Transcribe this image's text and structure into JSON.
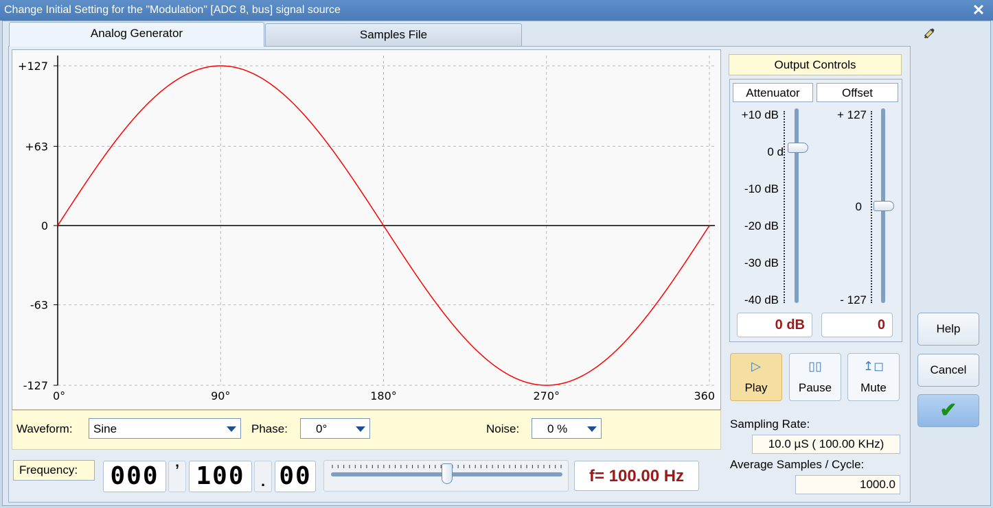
{
  "window": {
    "title": "Change Initial Setting for the \"Modulation\" [ADC 8, bus] signal source",
    "close_glyph": "✕"
  },
  "tabs": [
    {
      "label": "Analog Generator",
      "active": true
    },
    {
      "label": "Samples File",
      "active": false
    }
  ],
  "colors": {
    "accent": "#4a7cb8",
    "signal": "#ff0000",
    "highlight": "#fffbd6",
    "value_text": "#9a1a1a",
    "ok_check": "#1a8f1a"
  },
  "chart_data": {
    "type": "line",
    "series": [
      {
        "name": "",
        "function": "sine",
        "amplitude": 127,
        "x_range": [
          0,
          360
        ]
      }
    ],
    "x_tick_labels": [
      "0°",
      "90°",
      "180°",
      "270°",
      "360"
    ],
    "x_ticks": [
      0,
      90,
      180,
      270,
      360
    ],
    "y_tick_labels": [
      "+127",
      "+63",
      "0",
      "-63",
      "-127"
    ],
    "y_ticks": [
      127,
      63,
      0,
      -63,
      -127
    ],
    "xlim": [
      0,
      360
    ],
    "ylim": [
      -127,
      127
    ],
    "grid": true,
    "xlabel": "",
    "ylabel": ""
  },
  "waveform": {
    "label": "Waveform:",
    "value": "Sine"
  },
  "phase": {
    "label": "Phase:",
    "value": "0°"
  },
  "noise": {
    "label": "Noise:",
    "value": "0 %"
  },
  "frequency": {
    "label": "Frequency:",
    "digits_thousands": "000",
    "thousands_sep": "’",
    "digits_units": "100",
    "decimal_sep": ".",
    "digits_decimal": "00",
    "display": "f= 100.00 Hz",
    "slider_level": 0.5
  },
  "output_controls": {
    "title": "Output Controls",
    "attenuator": {
      "header": "Attenuator",
      "scale": [
        "+10 dB",
        "0 d",
        "-10 dB",
        "-20 dB",
        "-30 dB",
        "-40 dB"
      ],
      "value": "0 dB",
      "level_db": 0
    },
    "offset": {
      "header": "Offset",
      "scale": [
        "+ 127",
        "0",
        "- 127"
      ],
      "value": "0",
      "level": 0
    }
  },
  "transport": {
    "play": {
      "label": "Play",
      "icon": "play-icon"
    },
    "pause": {
      "label": "Pause",
      "icon": "pause-icon"
    },
    "mute": {
      "label": "Mute",
      "icon": "mute-icon"
    }
  },
  "sampling": {
    "rate_label": "Sampling Rate:",
    "rate_value": "10.0 µS ( 100.00 KHz)",
    "avg_label": "Average Samples / Cycle:",
    "avg_value": "1000.0"
  },
  "side_buttons": {
    "help": "Help",
    "cancel": "Cancel",
    "ok_glyph": "✔"
  },
  "icons": {
    "pin": "pin-icon"
  }
}
